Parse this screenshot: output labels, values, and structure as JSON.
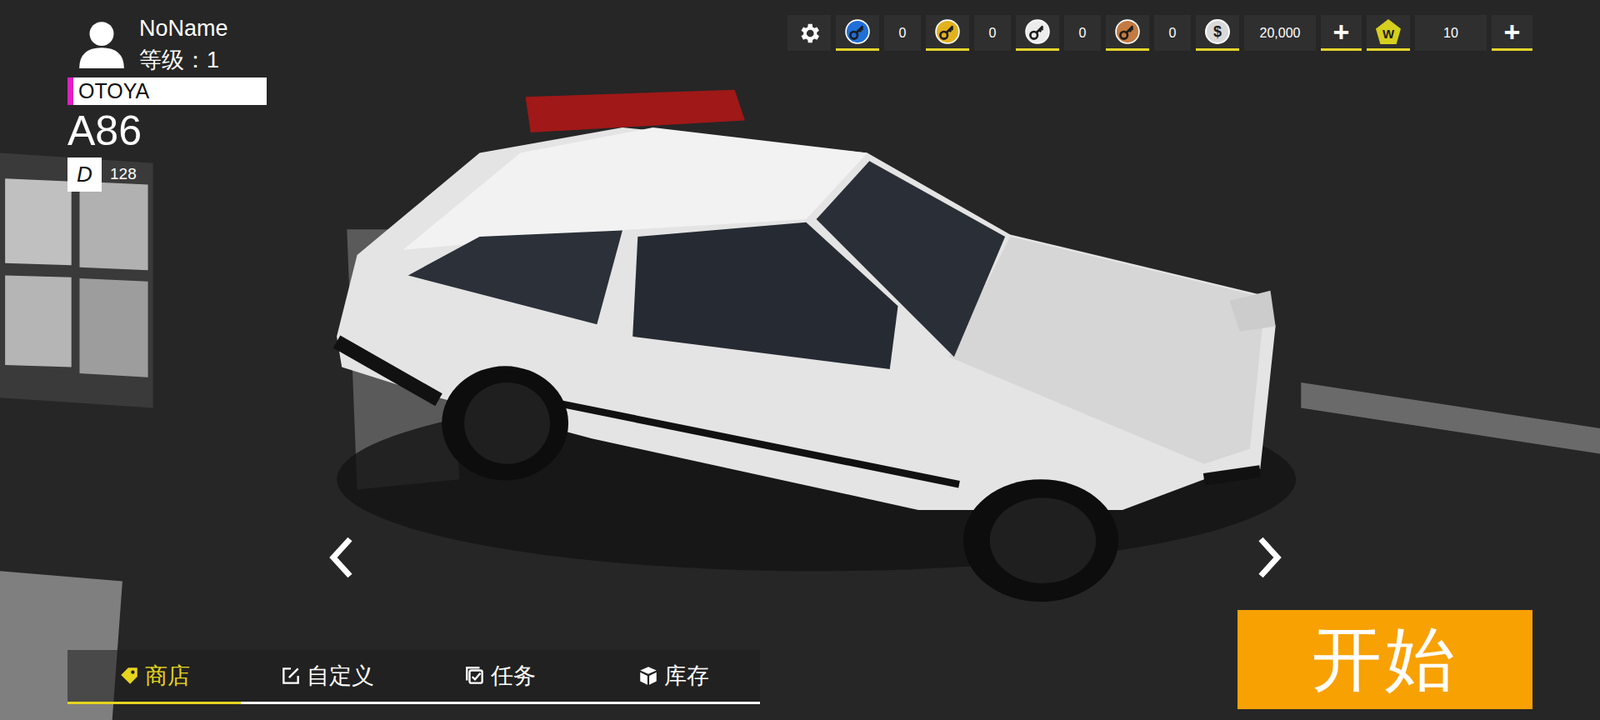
{
  "profile": {
    "name": "NoName",
    "level_label": "等级：1"
  },
  "car": {
    "brand": "OTOYA",
    "model": "A86",
    "class": "D",
    "rating": "128"
  },
  "add_symbol": "+",
  "currencies": [
    {
      "kind": "key",
      "value": "0",
      "color": "#1f6fd8",
      "addable": false
    },
    {
      "kind": "key",
      "value": "0",
      "color": "#e2b21e",
      "addable": false
    },
    {
      "kind": "key",
      "value": "0",
      "color": "#ececec",
      "addable": false
    },
    {
      "kind": "key",
      "value": "0",
      "color": "#c47a42",
      "addable": false
    },
    {
      "kind": "coin",
      "symbol": "$",
      "value": "20,000",
      "color": "#d9d9d9",
      "addable": true
    },
    {
      "kind": "gem",
      "symbol": "W",
      "value": "10",
      "color": "#d6cf1e",
      "addable": true
    }
  ],
  "nav": [
    {
      "label": "商店",
      "selected": true
    },
    {
      "label": "自定义",
      "selected": false
    },
    {
      "label": "任务",
      "selected": false
    },
    {
      "label": "库存",
      "selected": false
    }
  ],
  "start_button": "开始"
}
